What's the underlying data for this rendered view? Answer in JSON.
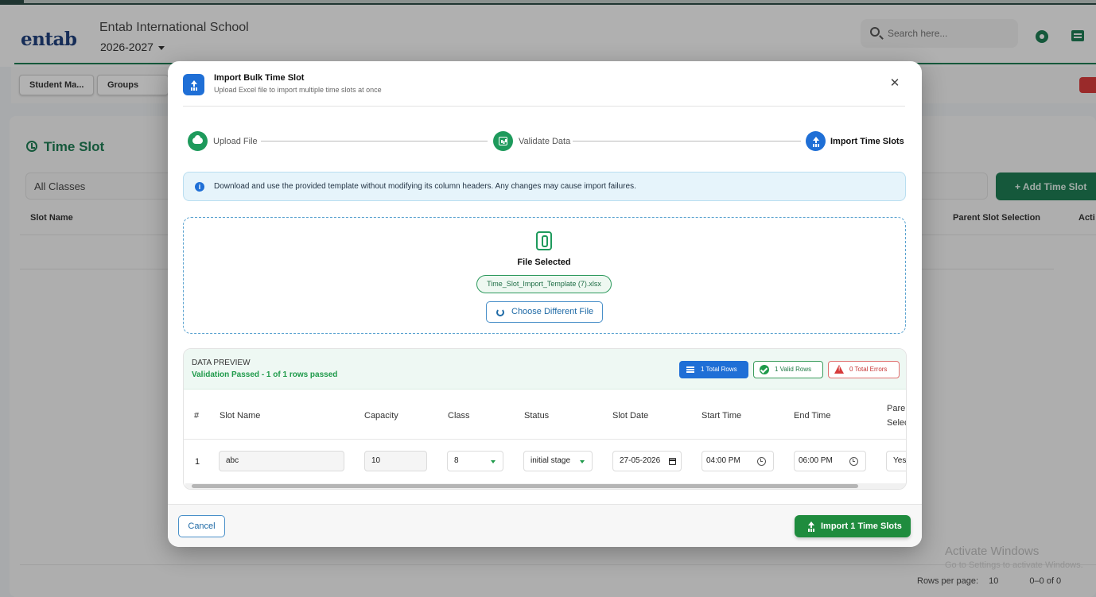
{
  "app": {
    "logo_text": "entab",
    "school_name": "Entab International School",
    "session": "2026-2027",
    "search_placeholder": "Search here...",
    "nav": [
      "Student Ma...",
      "Groups"
    ],
    "page_title": "Time Slot",
    "class_filter": "All Classes",
    "add_button": "+ Add Time Slot",
    "table_headers": {
      "slot_name": "Slot Name",
      "parent_slot": "Parent Slot Selection",
      "action": "Acti"
    },
    "pagination": {
      "rows_per_page_label": "Rows per page:",
      "rows_per_page": "10",
      "range": "0–0 of 0"
    },
    "watermark": {
      "line1": "Activate Windows",
      "line2": "Go to Settings to activate Windows."
    }
  },
  "modal": {
    "title": "Import Bulk Time Slot",
    "subtitle": "Upload Excel file to import multiple time slots at once",
    "close_glyph": "✕",
    "steps": [
      {
        "label": "Upload File",
        "state": "done",
        "color": "#1e9a5c",
        "icon": "cloud-upload-icon"
      },
      {
        "label": "Validate Data",
        "state": "done",
        "color": "#1e9a5c",
        "icon": "chart-icon"
      },
      {
        "label": "Import Time Slots",
        "state": "active",
        "color": "#1f6fd6",
        "icon": "upload-icon"
      }
    ],
    "info_text": "Download and use the provided template without modifying its column headers. Any changes may cause import failures.",
    "file": {
      "status": "File Selected",
      "file_name": "Time_Slot_Import_Template (7).xlsx",
      "choose_label": "Choose Different File"
    },
    "preview": {
      "title": "DATA PREVIEW",
      "status": "Validation Passed - 1 of 1 rows passed",
      "badges": {
        "total": "1 Total Rows",
        "valid": "1 Valid Rows",
        "errors": "0 Total Errors"
      },
      "columns": [
        "#",
        "Slot Name",
        "Capacity",
        "Class",
        "Status",
        "Slot Date",
        "Start Time",
        "End Time"
      ],
      "parent_column": {
        "line1": "Parent",
        "line2": "Selection"
      },
      "rows": [
        {
          "num": "1",
          "slot_name": "abc",
          "capacity": "10",
          "class": "8",
          "status": "initial stage",
          "slot_date": "27-05-2026",
          "start_time": "04:00 PM",
          "end_time": "06:00 PM",
          "parent": "Yes"
        }
      ]
    },
    "footer": {
      "cancel": "Cancel",
      "import": "Import 1 Time Slots"
    }
  },
  "colors": {
    "brand_green": "#1e7a52",
    "accent_blue": "#1f6fd6",
    "success_green": "#1e9a4a",
    "error_red": "#d63b3b"
  }
}
